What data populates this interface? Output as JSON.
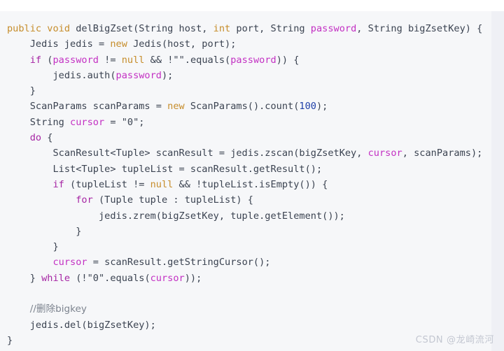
{
  "panel": {
    "background_color": "#f6f7f9",
    "page_background_color": "#ffffff",
    "scrollbar_color": "#eff0f5"
  },
  "theme": {
    "default_text": "#3b4351",
    "keyword_modifier": "#c68d2b",
    "keyword_control": "#a626a4",
    "parameter": "#c330c3",
    "number": "#1f3fa8",
    "comment": "#7d848f",
    "watermark": "#c3c7d1"
  },
  "code": {
    "language": "Java",
    "lines": [
      {
        "n": 1,
        "indent": 0,
        "tokens": [
          {
            "t": "public",
            "c": "kw"
          },
          {
            "t": " ",
            "c": "plain"
          },
          {
            "t": "void",
            "c": "kw"
          },
          {
            "t": " delBigZset(String host, ",
            "c": "plain"
          },
          {
            "t": "int",
            "c": "kw"
          },
          {
            "t": " port, String ",
            "c": "plain"
          },
          {
            "t": "password",
            "c": "param"
          },
          {
            "t": ", String bigZsetKey) {",
            "c": "plain"
          }
        ]
      },
      {
        "n": 2,
        "indent": 1,
        "tokens": [
          {
            "t": "Jedis jedis = ",
            "c": "plain"
          },
          {
            "t": "new",
            "c": "kw"
          },
          {
            "t": " Jedis(host, port);",
            "c": "plain"
          }
        ]
      },
      {
        "n": 3,
        "indent": 1,
        "tokens": [
          {
            "t": "if",
            "c": "ctl"
          },
          {
            "t": " (",
            "c": "plain"
          },
          {
            "t": "password",
            "c": "param"
          },
          {
            "t": " != ",
            "c": "plain"
          },
          {
            "t": "null",
            "c": "kw"
          },
          {
            "t": " && !\"\".equals(",
            "c": "plain"
          },
          {
            "t": "password",
            "c": "param"
          },
          {
            "t": ")) {",
            "c": "plain"
          }
        ]
      },
      {
        "n": 4,
        "indent": 2,
        "tokens": [
          {
            "t": "jedis.auth(",
            "c": "plain"
          },
          {
            "t": "password",
            "c": "param"
          },
          {
            "t": ");",
            "c": "plain"
          }
        ]
      },
      {
        "n": 5,
        "indent": 1,
        "tokens": [
          {
            "t": "}",
            "c": "plain"
          }
        ]
      },
      {
        "n": 6,
        "indent": 1,
        "tokens": [
          {
            "t": "ScanParams scanParams = ",
            "c": "plain"
          },
          {
            "t": "new",
            "c": "kw"
          },
          {
            "t": " ScanParams().count(",
            "c": "plain"
          },
          {
            "t": "100",
            "c": "num"
          },
          {
            "t": ");",
            "c": "plain"
          }
        ]
      },
      {
        "n": 7,
        "indent": 1,
        "tokens": [
          {
            "t": "String ",
            "c": "plain"
          },
          {
            "t": "cursor",
            "c": "param"
          },
          {
            "t": " = \"0\";",
            "c": "plain"
          }
        ]
      },
      {
        "n": 8,
        "indent": 1,
        "tokens": [
          {
            "t": "do",
            "c": "ctl"
          },
          {
            "t": " {",
            "c": "plain"
          }
        ]
      },
      {
        "n": 9,
        "indent": 2,
        "tokens": [
          {
            "t": "ScanResult<Tuple> scanResult = jedis.zscan(bigZsetKey, ",
            "c": "plain"
          },
          {
            "t": "cursor",
            "c": "param"
          },
          {
            "t": ", scanParams);",
            "c": "plain"
          }
        ]
      },
      {
        "n": 10,
        "indent": 2,
        "tokens": [
          {
            "t": "List<Tuple> tupleList = scanResult.getResult();",
            "c": "plain"
          }
        ]
      },
      {
        "n": 11,
        "indent": 2,
        "tokens": [
          {
            "t": "if",
            "c": "ctl"
          },
          {
            "t": " (tupleList != ",
            "c": "plain"
          },
          {
            "t": "null",
            "c": "kw"
          },
          {
            "t": " && !tupleList.isEmpty()) {",
            "c": "plain"
          }
        ]
      },
      {
        "n": 12,
        "indent": 3,
        "tokens": [
          {
            "t": "for",
            "c": "ctl"
          },
          {
            "t": " (Tuple tuple : tupleList) {",
            "c": "plain"
          }
        ]
      },
      {
        "n": 13,
        "indent": 4,
        "tokens": [
          {
            "t": "jedis.zrem(bigZsetKey, tuple.getElement());",
            "c": "plain"
          }
        ]
      },
      {
        "n": 14,
        "indent": 3,
        "tokens": [
          {
            "t": "}",
            "c": "plain"
          }
        ]
      },
      {
        "n": 15,
        "indent": 2,
        "tokens": [
          {
            "t": "}",
            "c": "plain"
          }
        ]
      },
      {
        "n": 16,
        "indent": 2,
        "tokens": [
          {
            "t": "cursor",
            "c": "param"
          },
          {
            "t": " = scanResult.getStringCursor();",
            "c": "plain"
          }
        ]
      },
      {
        "n": 17,
        "indent": 1,
        "tokens": [
          {
            "t": "} ",
            "c": "plain"
          },
          {
            "t": "while",
            "c": "ctl"
          },
          {
            "t": " (!\"0\".equals(",
            "c": "plain"
          },
          {
            "t": "cursor",
            "c": "param"
          },
          {
            "t": "));",
            "c": "plain"
          }
        ]
      },
      {
        "n": 18,
        "indent": 0,
        "tokens": []
      },
      {
        "n": 19,
        "indent": 1,
        "tokens": [
          {
            "t": "//删除bigkey",
            "c": "cmt"
          }
        ]
      },
      {
        "n": 20,
        "indent": 1,
        "tokens": [
          {
            "t": "jedis.del(bigZsetKey);",
            "c": "plain"
          }
        ]
      },
      {
        "n": 21,
        "indent": 0,
        "tokens": [
          {
            "t": "}",
            "c": "plain"
          }
        ]
      }
    ]
  },
  "watermark": {
    "text": "CSDN @龙崎流河"
  }
}
